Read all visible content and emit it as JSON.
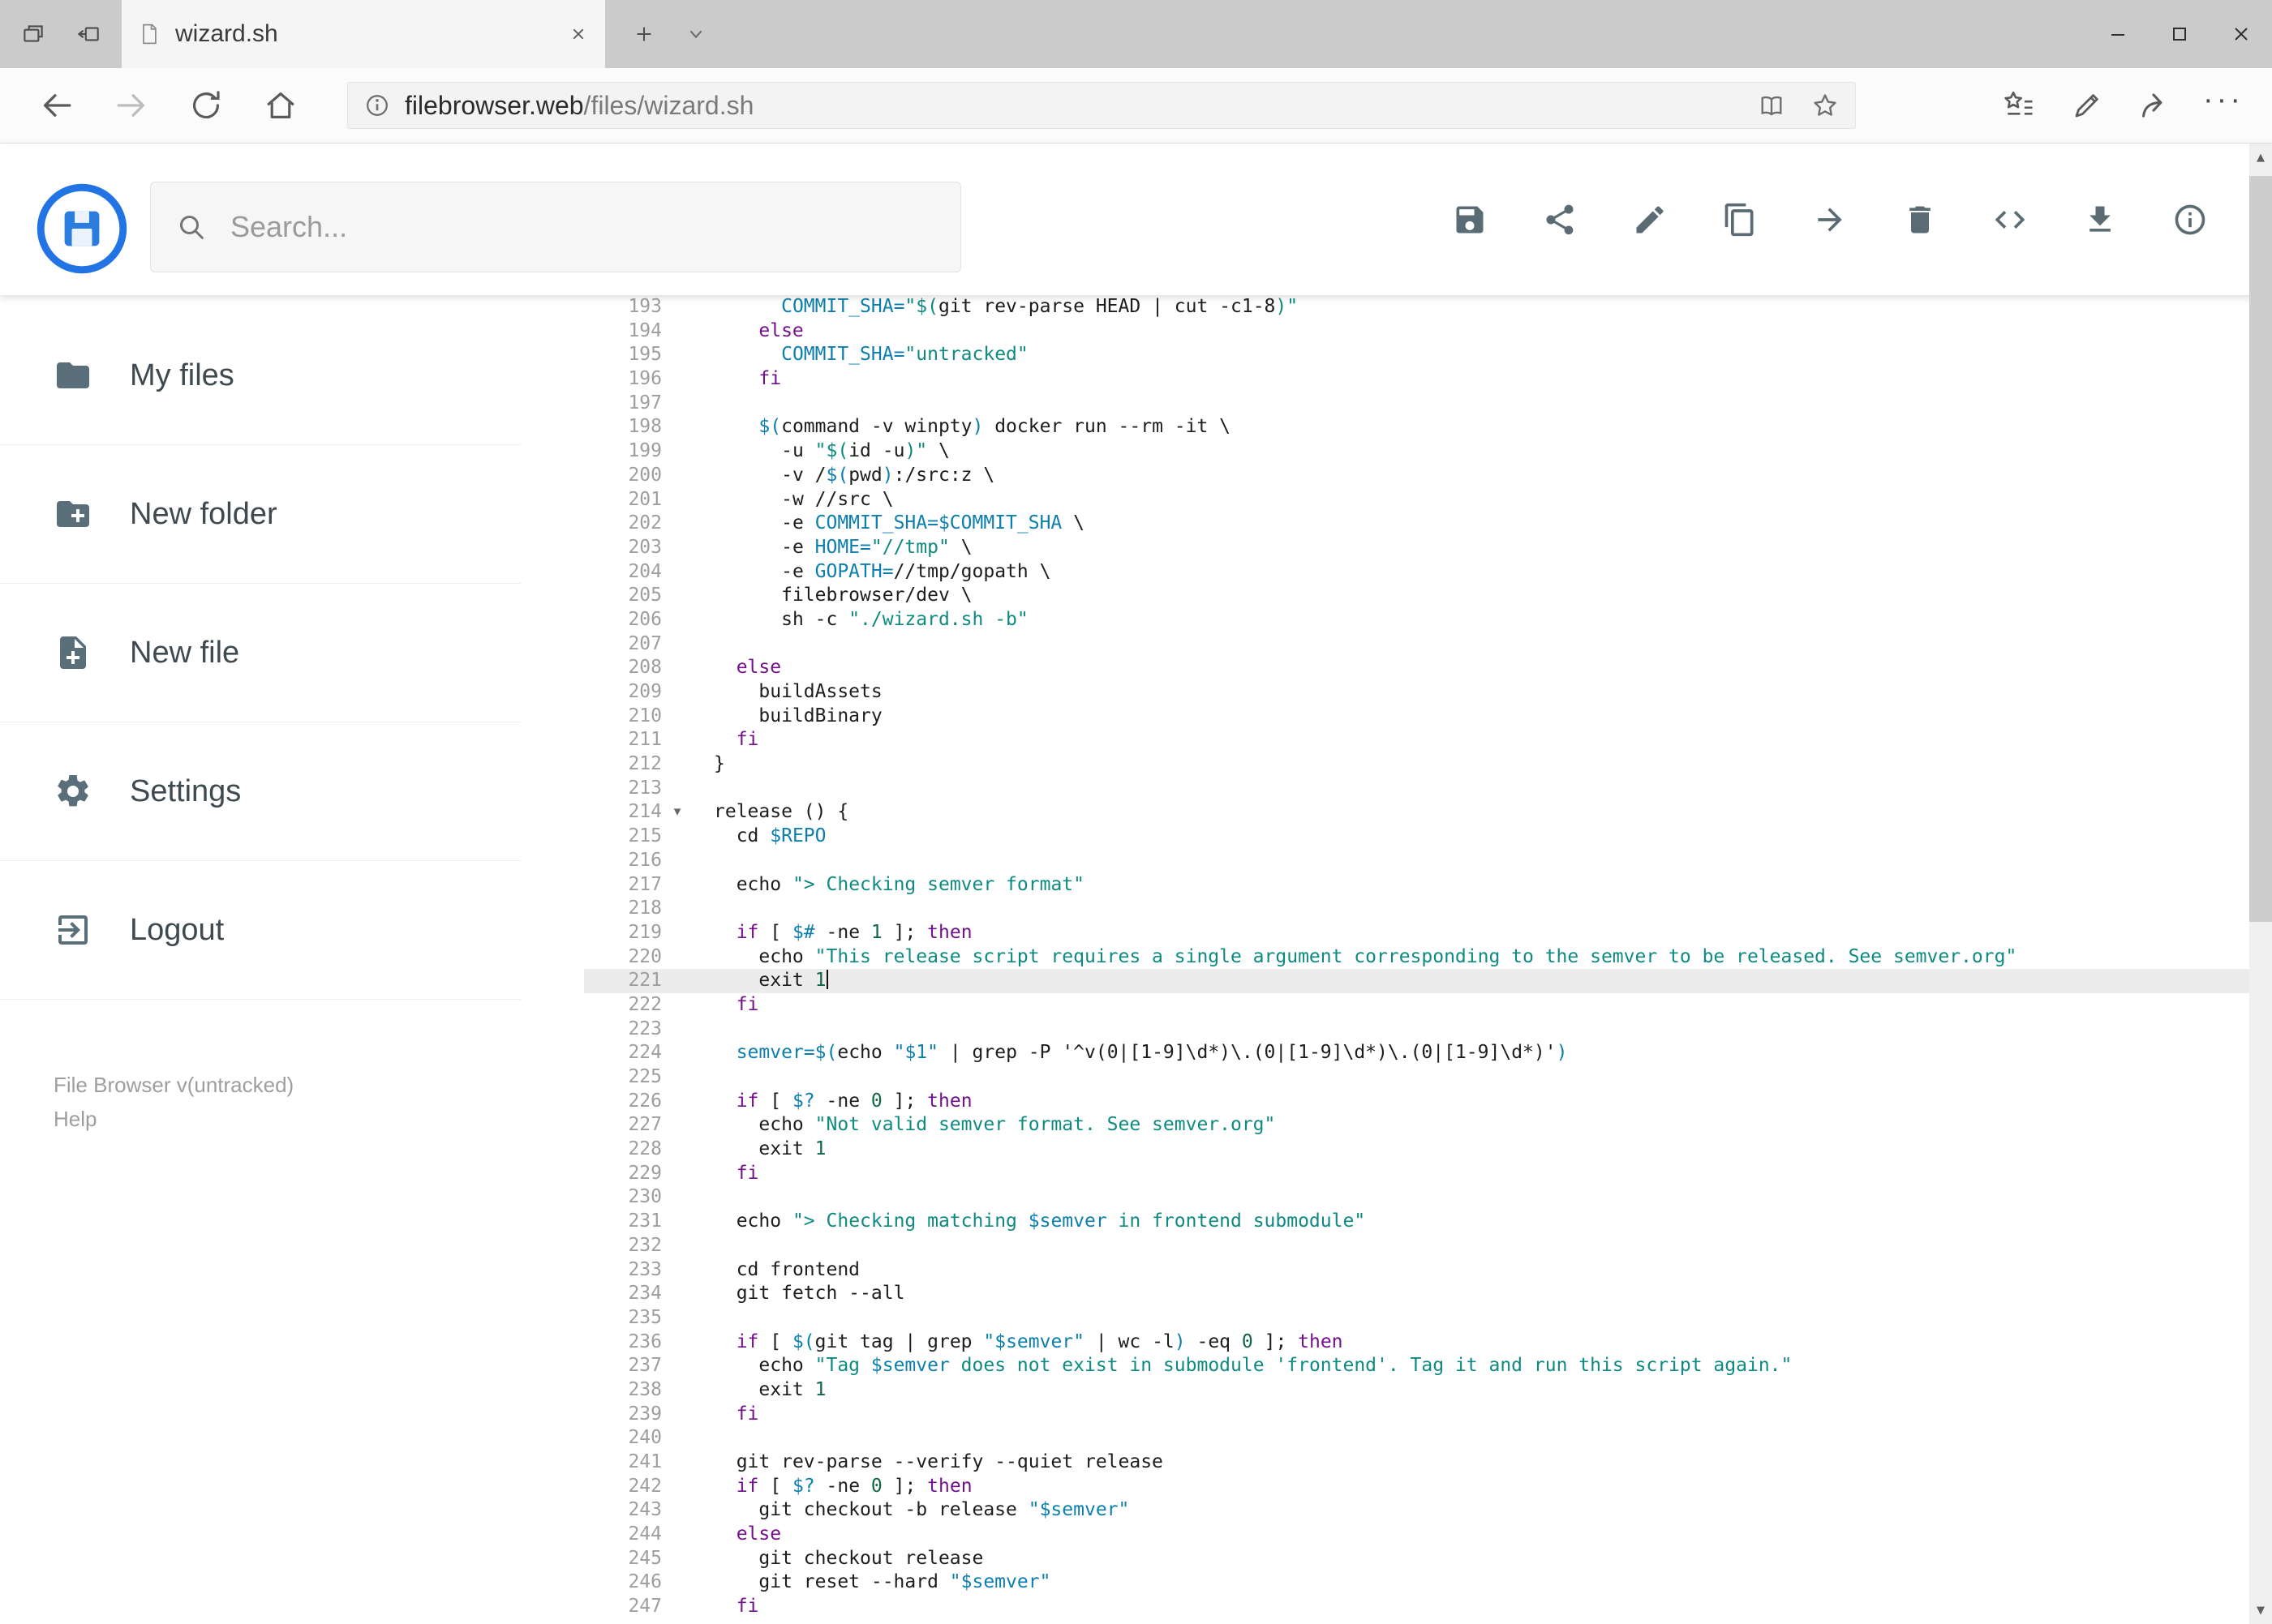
{
  "browser": {
    "tab_title": "wizard.sh",
    "url_host": "filebrowser.web",
    "url_path": "/files/wizard.sh",
    "window_controls": [
      "minimize",
      "maximize",
      "close"
    ]
  },
  "header": {
    "search_placeholder": "Search...",
    "actions": [
      "save",
      "share",
      "rename",
      "copy",
      "move",
      "delete",
      "code",
      "download",
      "info"
    ]
  },
  "sidebar": {
    "items": [
      {
        "label": "My files",
        "icon": "folder"
      },
      {
        "label": "New folder",
        "icon": "create-new-folder"
      },
      {
        "label": "New file",
        "icon": "new-file"
      },
      {
        "label": "Settings",
        "icon": "settings-gear"
      },
      {
        "label": "Logout",
        "icon": "logout"
      }
    ],
    "footer": {
      "version": "File Browser v(untracked)",
      "help_label": "Help"
    }
  },
  "editor": {
    "first_line": 193,
    "active_line": 221,
    "lines": [
      {
        "n": 193,
        "ind": 6,
        "s": [
          [
            "v",
            "COMMIT_SHA="
          ],
          [
            "s",
            "\"$("
          ],
          [
            "p",
            "git rev-parse HEAD | cut -c1-8"
          ],
          [
            "s",
            ")\""
          ]
        ]
      },
      {
        "n": 194,
        "ind": 4,
        "s": [
          [
            "k",
            "else"
          ]
        ]
      },
      {
        "n": 195,
        "ind": 6,
        "s": [
          [
            "v",
            "COMMIT_SHA="
          ],
          [
            "s",
            "\"untracked\""
          ]
        ]
      },
      {
        "n": 196,
        "ind": 4,
        "s": [
          [
            "k",
            "fi"
          ]
        ]
      },
      {
        "n": 197,
        "ind": 0,
        "s": []
      },
      {
        "n": 198,
        "ind": 4,
        "s": [
          [
            "v",
            "$("
          ],
          [
            "p",
            "command -v winpty"
          ],
          [
            "v",
            ")"
          ],
          [
            "p",
            " docker run --rm -it \\"
          ]
        ]
      },
      {
        "n": 199,
        "ind": 6,
        "s": [
          [
            "p",
            "-u "
          ],
          [
            "s",
            "\"$("
          ],
          [
            "p",
            "id -u"
          ],
          [
            "s",
            ")\""
          ],
          [
            "p",
            " \\"
          ]
        ]
      },
      {
        "n": 200,
        "ind": 6,
        "s": [
          [
            "p",
            "-v /"
          ],
          [
            "v",
            "$("
          ],
          [
            "p",
            "pwd"
          ],
          [
            "v",
            ")"
          ],
          [
            "p",
            ":/src:z \\"
          ]
        ]
      },
      {
        "n": 201,
        "ind": 6,
        "s": [
          [
            "p",
            "-w //src \\"
          ]
        ]
      },
      {
        "n": 202,
        "ind": 6,
        "s": [
          [
            "p",
            "-e "
          ],
          [
            "v",
            "COMMIT_SHA=$COMMIT_SHA"
          ],
          [
            "p",
            " \\"
          ]
        ]
      },
      {
        "n": 203,
        "ind": 6,
        "s": [
          [
            "p",
            "-e "
          ],
          [
            "v",
            "HOME="
          ],
          [
            "s",
            "\"//tmp\""
          ],
          [
            "p",
            " \\"
          ]
        ]
      },
      {
        "n": 204,
        "ind": 6,
        "s": [
          [
            "p",
            "-e "
          ],
          [
            "v",
            "GOPATH="
          ],
          [
            "p",
            "//tmp/gopath \\"
          ]
        ]
      },
      {
        "n": 205,
        "ind": 6,
        "s": [
          [
            "p",
            "filebrowser/dev \\"
          ]
        ]
      },
      {
        "n": 206,
        "ind": 6,
        "s": [
          [
            "p",
            "sh -c "
          ],
          [
            "s",
            "\"./wizard.sh -b\""
          ]
        ]
      },
      {
        "n": 207,
        "ind": 0,
        "s": []
      },
      {
        "n": 208,
        "ind": 2,
        "s": [
          [
            "k",
            "else"
          ]
        ]
      },
      {
        "n": 209,
        "ind": 4,
        "s": [
          [
            "p",
            "buildAssets"
          ]
        ]
      },
      {
        "n": 210,
        "ind": 4,
        "s": [
          [
            "p",
            "buildBinary"
          ]
        ]
      },
      {
        "n": 211,
        "ind": 2,
        "s": [
          [
            "k",
            "fi"
          ]
        ]
      },
      {
        "n": 212,
        "ind": 0,
        "s": [
          [
            "p",
            "}"
          ]
        ]
      },
      {
        "n": 213,
        "ind": 0,
        "s": []
      },
      {
        "n": 214,
        "ind": 0,
        "fold": true,
        "s": [
          [
            "p",
            "release () {"
          ]
        ]
      },
      {
        "n": 215,
        "ind": 2,
        "s": [
          [
            "p",
            "cd "
          ],
          [
            "v",
            "$REPO"
          ]
        ]
      },
      {
        "n": 216,
        "ind": 0,
        "s": []
      },
      {
        "n": 217,
        "ind": 2,
        "s": [
          [
            "p",
            "echo "
          ],
          [
            "s",
            "\"> Checking semver format\""
          ]
        ]
      },
      {
        "n": 218,
        "ind": 0,
        "s": []
      },
      {
        "n": 219,
        "ind": 2,
        "s": [
          [
            "k",
            "if"
          ],
          [
            "p",
            " [ "
          ],
          [
            "v",
            "$#"
          ],
          [
            "p",
            " -ne "
          ],
          [
            "n",
            "1"
          ],
          [
            "p",
            " ]; "
          ],
          [
            "k",
            "then"
          ]
        ]
      },
      {
        "n": 220,
        "ind": 4,
        "s": [
          [
            "p",
            "echo "
          ],
          [
            "s",
            "\"This release script requires a single argument corresponding to the semver to be released. See semver.org\""
          ]
        ]
      },
      {
        "n": 221,
        "ind": 4,
        "active": true,
        "caret": true,
        "s": [
          [
            "p",
            "exit "
          ],
          [
            "n",
            "1"
          ]
        ]
      },
      {
        "n": 222,
        "ind": 2,
        "s": [
          [
            "k",
            "fi"
          ]
        ]
      },
      {
        "n": 223,
        "ind": 0,
        "s": []
      },
      {
        "n": 224,
        "ind": 2,
        "s": [
          [
            "v",
            "semver="
          ],
          [
            "v",
            "$("
          ],
          [
            "p",
            "echo "
          ],
          [
            "v",
            "\"$1\""
          ],
          [
            "p",
            " | grep -P "
          ],
          [
            "p",
            "'^v(0|[1-9]\\d*)\\.(0|[1-9]\\d*)\\.(0|[1-9]\\d*)'"
          ],
          [
            "v",
            ")"
          ]
        ]
      },
      {
        "n": 225,
        "ind": 0,
        "s": []
      },
      {
        "n": 226,
        "ind": 2,
        "s": [
          [
            "k",
            "if"
          ],
          [
            "p",
            " [ "
          ],
          [
            "v",
            "$?"
          ],
          [
            "p",
            " -ne "
          ],
          [
            "n",
            "0"
          ],
          [
            "p",
            " ]; "
          ],
          [
            "k",
            "then"
          ]
        ]
      },
      {
        "n": 227,
        "ind": 4,
        "s": [
          [
            "p",
            "echo "
          ],
          [
            "s",
            "\"Not valid semver format. See semver.org\""
          ]
        ]
      },
      {
        "n": 228,
        "ind": 4,
        "s": [
          [
            "p",
            "exit "
          ],
          [
            "n",
            "1"
          ]
        ]
      },
      {
        "n": 229,
        "ind": 2,
        "s": [
          [
            "k",
            "fi"
          ]
        ]
      },
      {
        "n": 230,
        "ind": 0,
        "s": []
      },
      {
        "n": 231,
        "ind": 2,
        "s": [
          [
            "p",
            "echo "
          ],
          [
            "s",
            "\"> Checking matching "
          ],
          [
            "v",
            "$semver"
          ],
          [
            "s",
            " in frontend submodule\""
          ]
        ]
      },
      {
        "n": 232,
        "ind": 0,
        "s": []
      },
      {
        "n": 233,
        "ind": 2,
        "s": [
          [
            "p",
            "cd frontend"
          ]
        ]
      },
      {
        "n": 234,
        "ind": 2,
        "s": [
          [
            "p",
            "git fetch --all"
          ]
        ]
      },
      {
        "n": 235,
        "ind": 0,
        "s": []
      },
      {
        "n": 236,
        "ind": 2,
        "s": [
          [
            "k",
            "if"
          ],
          [
            "p",
            " [ "
          ],
          [
            "v",
            "$("
          ],
          [
            "p",
            "git tag | grep "
          ],
          [
            "v",
            "\"$semver\""
          ],
          [
            "p",
            " | wc -l"
          ],
          [
            "v",
            ")"
          ],
          [
            "p",
            " -eq "
          ],
          [
            "n",
            "0"
          ],
          [
            "p",
            " ]; "
          ],
          [
            "k",
            "then"
          ]
        ]
      },
      {
        "n": 237,
        "ind": 4,
        "s": [
          [
            "p",
            "echo "
          ],
          [
            "s",
            "\"Tag "
          ],
          [
            "v",
            "$semver"
          ],
          [
            "s",
            " does not exist in submodule 'frontend'. Tag it and run this script again.\""
          ]
        ]
      },
      {
        "n": 238,
        "ind": 4,
        "s": [
          [
            "p",
            "exit "
          ],
          [
            "n",
            "1"
          ]
        ]
      },
      {
        "n": 239,
        "ind": 2,
        "s": [
          [
            "k",
            "fi"
          ]
        ]
      },
      {
        "n": 240,
        "ind": 0,
        "s": []
      },
      {
        "n": 241,
        "ind": 2,
        "s": [
          [
            "p",
            "git rev-parse --verify --quiet release"
          ]
        ]
      },
      {
        "n": 242,
        "ind": 2,
        "s": [
          [
            "k",
            "if"
          ],
          [
            "p",
            " [ "
          ],
          [
            "v",
            "$?"
          ],
          [
            "p",
            " -ne "
          ],
          [
            "n",
            "0"
          ],
          [
            "p",
            " ]; "
          ],
          [
            "k",
            "then"
          ]
        ]
      },
      {
        "n": 243,
        "ind": 4,
        "s": [
          [
            "p",
            "git checkout -b release "
          ],
          [
            "v",
            "\"$semver\""
          ]
        ]
      },
      {
        "n": 244,
        "ind": 2,
        "s": [
          [
            "k",
            "else"
          ]
        ]
      },
      {
        "n": 245,
        "ind": 4,
        "s": [
          [
            "p",
            "git checkout release"
          ]
        ]
      },
      {
        "n": 246,
        "ind": 4,
        "s": [
          [
            "p",
            "git reset --hard "
          ],
          [
            "v",
            "\"$semver\""
          ]
        ]
      },
      {
        "n": 247,
        "ind": 2,
        "s": [
          [
            "k",
            "fi"
          ]
        ]
      }
    ]
  }
}
